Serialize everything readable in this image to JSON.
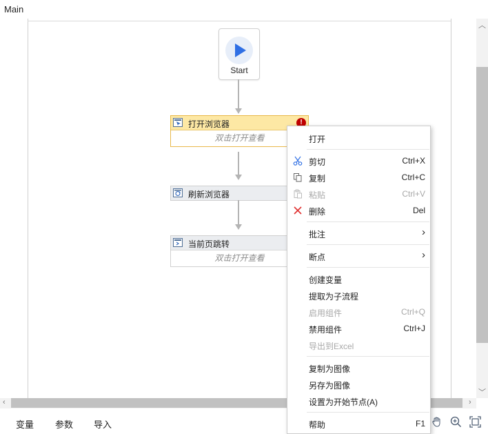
{
  "tab": {
    "title": "Main"
  },
  "start": {
    "label": "Start"
  },
  "activities": [
    {
      "title": "打开浏览器",
      "body": "双击打开查看",
      "error": "!"
    },
    {
      "title": "刷新浏览器"
    },
    {
      "title": "当前页跳转",
      "body": "双击打开查看"
    }
  ],
  "context_menu": {
    "open": "打开",
    "cut": {
      "label": "剪切",
      "shortcut": "Ctrl+X"
    },
    "copy": {
      "label": "复制",
      "shortcut": "Ctrl+C"
    },
    "paste": {
      "label": "粘贴",
      "shortcut": "Ctrl+V"
    },
    "delete": {
      "label": "删除",
      "shortcut": "Del"
    },
    "annotate": {
      "label": "批注",
      "arrow": "›"
    },
    "breakpoint": {
      "label": "断点",
      "arrow": "›"
    },
    "create_variable": "创建变量",
    "extract_subflow": "提取为子流程",
    "enable_component": {
      "label": "启用组件",
      "shortcut": "Ctrl+Q"
    },
    "disable_component": {
      "label": "禁用组件",
      "shortcut": "Ctrl+J"
    },
    "export_excel": "导出到Excel",
    "copy_as_image": "复制为图像",
    "save_as_image": "另存为图像",
    "set_start_node": "设置为开始节点(A)",
    "help": {
      "label": "帮助",
      "shortcut": "F1"
    }
  },
  "bottom_tabs": [
    "变量",
    "参数",
    "导入"
  ],
  "scroll_arrows": {
    "up": "︿",
    "down": "﹀",
    "left": "‹",
    "right": "›"
  },
  "colors": {
    "selected_header": "#fde8a4",
    "error": "#c00000",
    "start_play": "#2f6fe4",
    "delete_icon": "#e03030",
    "cut_icon": "#2f6fe4"
  }
}
